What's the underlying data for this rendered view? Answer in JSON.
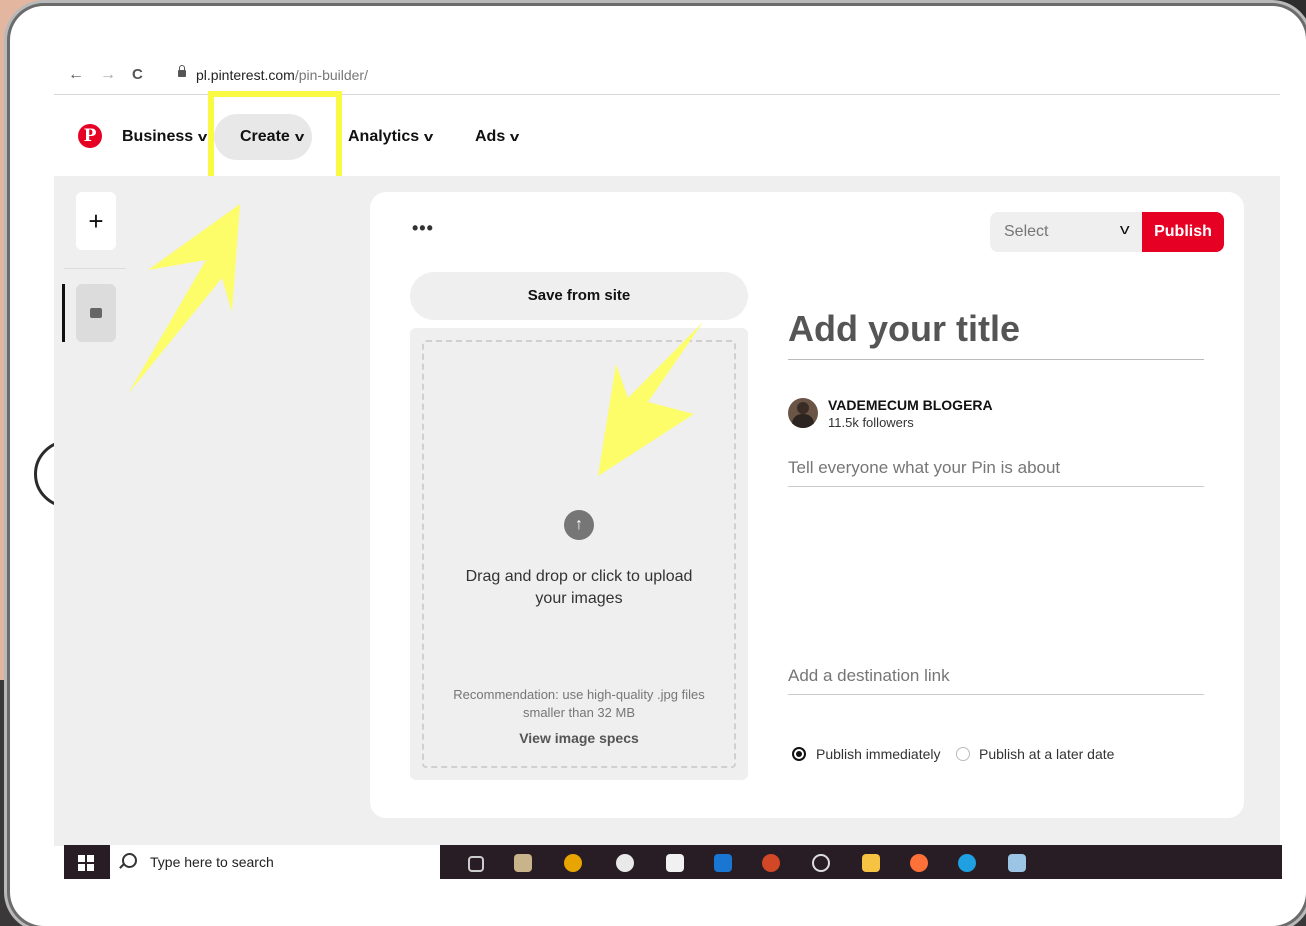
{
  "browser": {
    "url_domain": "pl.pinterest.com",
    "url_path": "/pin-builder/",
    "back_icon": "←",
    "forward_icon": "→",
    "reload_icon": "C"
  },
  "header": {
    "logo_letter": "P",
    "business_label": "Business",
    "create_label": "Create",
    "analytics_label": "Analytics",
    "ads_label": "Ads",
    "chevron": "v"
  },
  "sidebar": {
    "add_label": "+"
  },
  "card": {
    "more_label": "•••",
    "board_select": "Select",
    "publish_label": "Publish",
    "save_from_site": "Save from site",
    "upload_text": "Drag and drop or click to upload your images",
    "upload_icon": "↑",
    "recommendation": "Recommendation: use high-quality .jpg files smaller than 32 MB",
    "view_specs": "View image specs",
    "title_placeholder": "Add your title",
    "user_name": "VADEMECUM BLOGERA",
    "followers": "11.5k followers",
    "description_placeholder": "Tell everyone what your Pin is about",
    "link_placeholder": "Add a destination link",
    "publish_now": "Publish immediately",
    "publish_later": "Publish at a later date"
  },
  "taskbar": {
    "search_placeholder": "Type here to search"
  },
  "colors": {
    "pinterest_red": "#e60023",
    "highlight_yellow": "#fafa44"
  }
}
